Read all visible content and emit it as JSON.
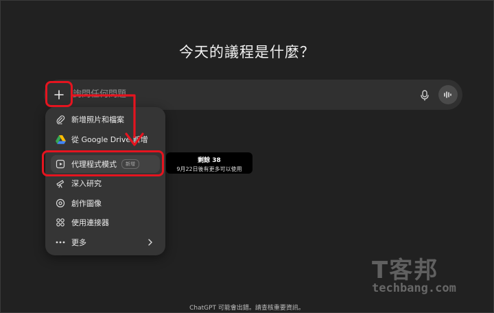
{
  "headline": "今天的議程是什麼？",
  "composer": {
    "placeholder": "詢問任何問題"
  },
  "menu": {
    "items": [
      {
        "label": "新增照片和檔案",
        "icon": "paperclip-icon"
      },
      {
        "label": "從 Google Drive 新增",
        "icon": "google-drive-icon"
      },
      {
        "label": "代理程式模式",
        "icon": "agent-mode-icon",
        "badge": "新增"
      },
      {
        "label": "深入研究",
        "icon": "telescope-icon"
      },
      {
        "label": "創作圖像",
        "icon": "image-create-icon"
      },
      {
        "label": "使用連接器",
        "icon": "connector-icon"
      },
      {
        "label": "更多",
        "icon": "more-dots-icon"
      }
    ]
  },
  "tooltip": {
    "title": "剩餘 38",
    "subtitle": "9月22日後有更多可以使用"
  },
  "disclaimer": "ChatGPT 可能會出錯。請查核重要資訊。",
  "watermark": {
    "logo": "T客邦",
    "url": "techbang.com"
  },
  "colors": {
    "background": "#212121",
    "composer": "#303030",
    "menu": "#353535",
    "highlight": "#e5141f"
  }
}
